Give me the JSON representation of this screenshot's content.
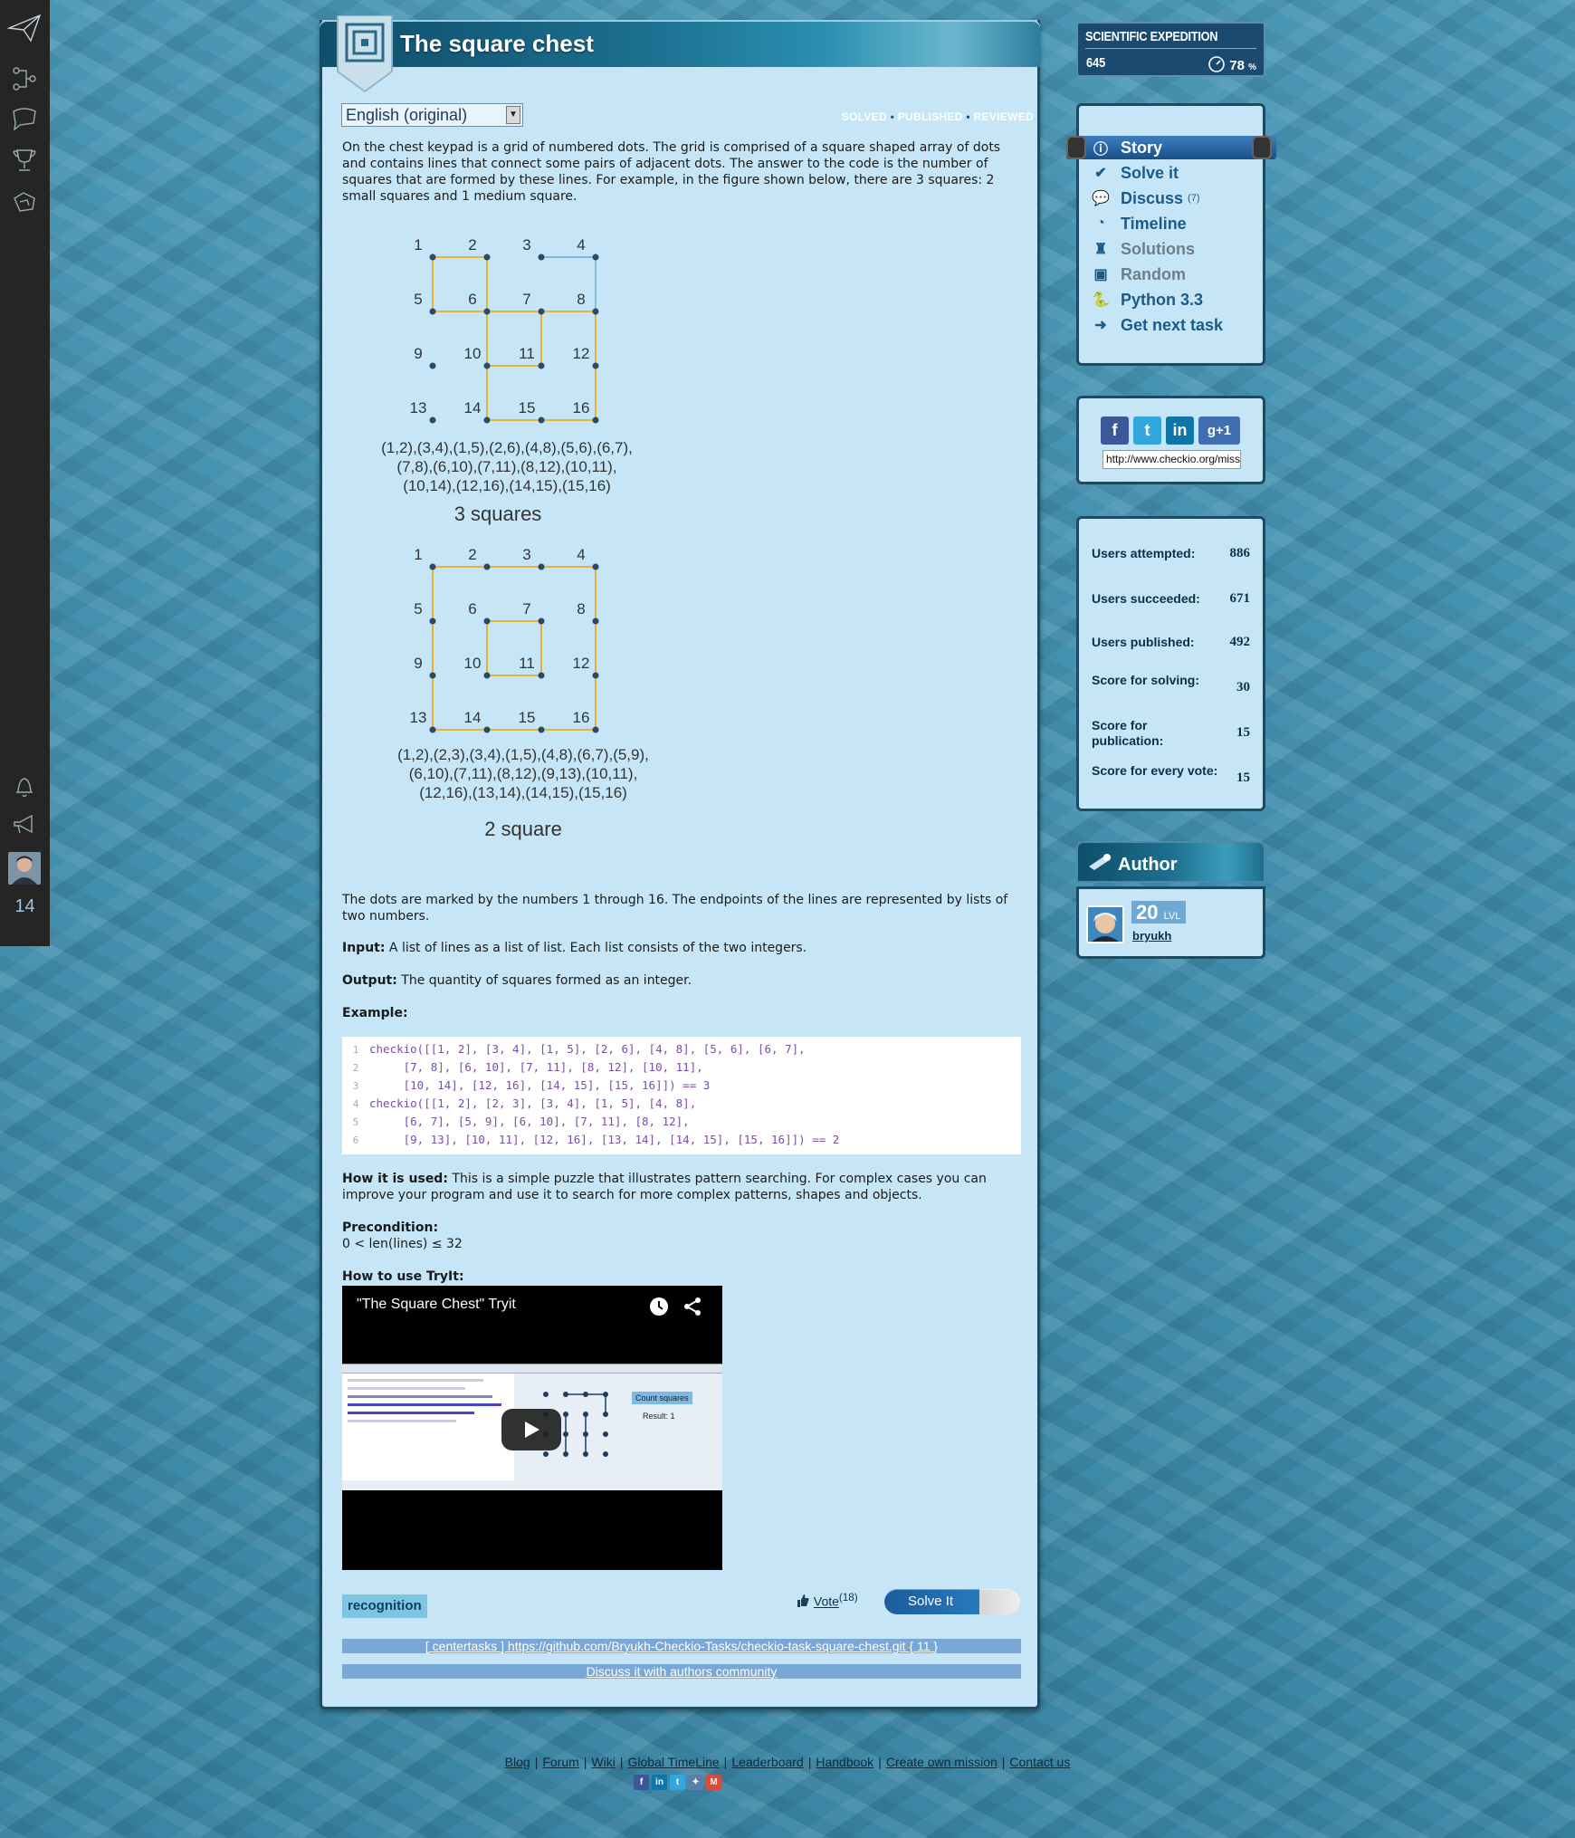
{
  "leftbar": {
    "notification_count": "14"
  },
  "mission": {
    "title": "The square chest"
  },
  "language_select": {
    "value": "English (original)"
  },
  "status": {
    "solved": "SOLVED",
    "published": "PUBLISHED",
    "reviewed": "REVIEWED",
    "sep": "•"
  },
  "story": {
    "intro": "On the chest keypad is a grid of numbered dots. The grid is comprised of a square shaped array of dots and contains lines that connect some pairs of adjacent dots. The answer to the code is the number of squares that are formed by these lines. For example, in the figure shown below, there are 3 squares: 2 small squares and 1 medium square.",
    "figure1": {
      "lines": [
        "(1,2),(3,4),(1,5),(2,6),(4,8),(5,6),(6,7),",
        "(7,8),(6,10),(7,11),(8,12),(10,11),",
        "(10,14),(12,16),(14,15),(15,16)"
      ],
      "caption": "3 squares"
    },
    "figure2": {
      "lines": [
        "(1,2),(2,3),(3,4),(1,5),(4,8),(6,7),(5,9),",
        "(6,10),(7,11),(8,12),(9,13),(10,11),",
        "(12,16),(13,14),(14,15),(15,16)"
      ],
      "caption": "2 square"
    },
    "dots_text": "The dots are marked by the numbers 1 through 16. The endpoints of the lines are represented by lists of two numbers.",
    "input_label": "Input:",
    "input_text": " A list of lines as a list of list. Each list consists of the two integers.",
    "output_label": "Output:",
    "output_text": " The quantity of squares formed as an integer.",
    "example_label": "Example:",
    "usage_label": "How it is used:",
    "usage_text": " This is a simple puzzle that illustrates pattern searching. For complex cases you can improve your program and use it to search for more complex patterns, shapes and objects.",
    "precondition_label": "Precondition:",
    "precondition_text": "0 < len(lines) ≤ 32",
    "tryit_label": "How to use TryIt:"
  },
  "code_lines": [
    {
      "n": "1",
      "text": "checkio([[1, 2], [3, 4], [1, 5], [2, 6], [4, 8], [5, 6], [6, 7],"
    },
    {
      "n": "2",
      "text": "     [7, 8], [6, 10], [7, 11], [8, 12], [10, 11],"
    },
    {
      "n": "3",
      "text": "     [10, 14], [12, 16], [14, 15], [15, 16]]) == 3"
    },
    {
      "n": "4",
      "text": "checkio([[1, 2], [2, 3], [3, 4], [1, 5], [4, 8],"
    },
    {
      "n": "5",
      "text": "     [6, 7], [5, 9], [6, 10], [7, 11], [8, 12],"
    },
    {
      "n": "6",
      "text": "     [9, 13], [10, 11], [12, 16], [13, 14], [14, 15], [15, 16]]) == 2"
    }
  ],
  "video": {
    "title": "\"The Square Chest\" Tryit",
    "screen_button": "Count squares",
    "screen_result": "Result: 1"
  },
  "tag": "recognition",
  "vote": {
    "label": "Vote",
    "count": "(18)"
  },
  "solve_button": "Solve It",
  "links": {
    "github": "[ centertasks ] https://github.com/Bryukh-Checkio-Tasks/checkio-task-square-chest.git { 11 }",
    "discuss": "Discuss it with authors community"
  },
  "expedition": {
    "title": "SCIENTIFIC EXPEDITION",
    "score": "645",
    "percent": "78",
    "percent_sign": "%"
  },
  "nav": [
    {
      "label": "Story",
      "icon": "info-icon",
      "active": true
    },
    {
      "label": "Solve it",
      "icon": "check-icon"
    },
    {
      "label": "Discuss",
      "icon": "discuss-icon",
      "count": "(7)"
    },
    {
      "label": "Timeline",
      "icon": "clock-icon"
    },
    {
      "label": "Solutions",
      "icon": "solutions-icon",
      "dim": true
    },
    {
      "label": "Random",
      "icon": "box-icon",
      "dim": true
    },
    {
      "label": "Python 3.3",
      "icon": "python-icon"
    },
    {
      "label": "Get next task",
      "icon": "arrow-right-icon"
    }
  ],
  "share": {
    "url": "http://www.checkio.org/mission"
  },
  "stats": [
    {
      "label": "Users attempted:",
      "value": "886"
    },
    {
      "label": "Users succeeded:",
      "value": "671"
    },
    {
      "label": "Users published:",
      "value": "492"
    },
    {
      "label": "Score for solving:",
      "value": "30"
    },
    {
      "label": "Score for publication:",
      "value": "15"
    },
    {
      "label": "Score for every vote:",
      "value": "15"
    }
  ],
  "author": {
    "title": "Author",
    "level": "20",
    "level_unit": "LVL",
    "name": "bryukh"
  },
  "footer": [
    "Blog",
    "Forum",
    "Wiki",
    "Global TimeLine",
    "Leaderboard",
    "Handbook",
    "Create own mission",
    "Contact us"
  ],
  "colors": {
    "accent": "#1a5b8a",
    "panel": "#c6e6f7",
    "line": "#e8b23a",
    "dot": "#2b4a66"
  }
}
